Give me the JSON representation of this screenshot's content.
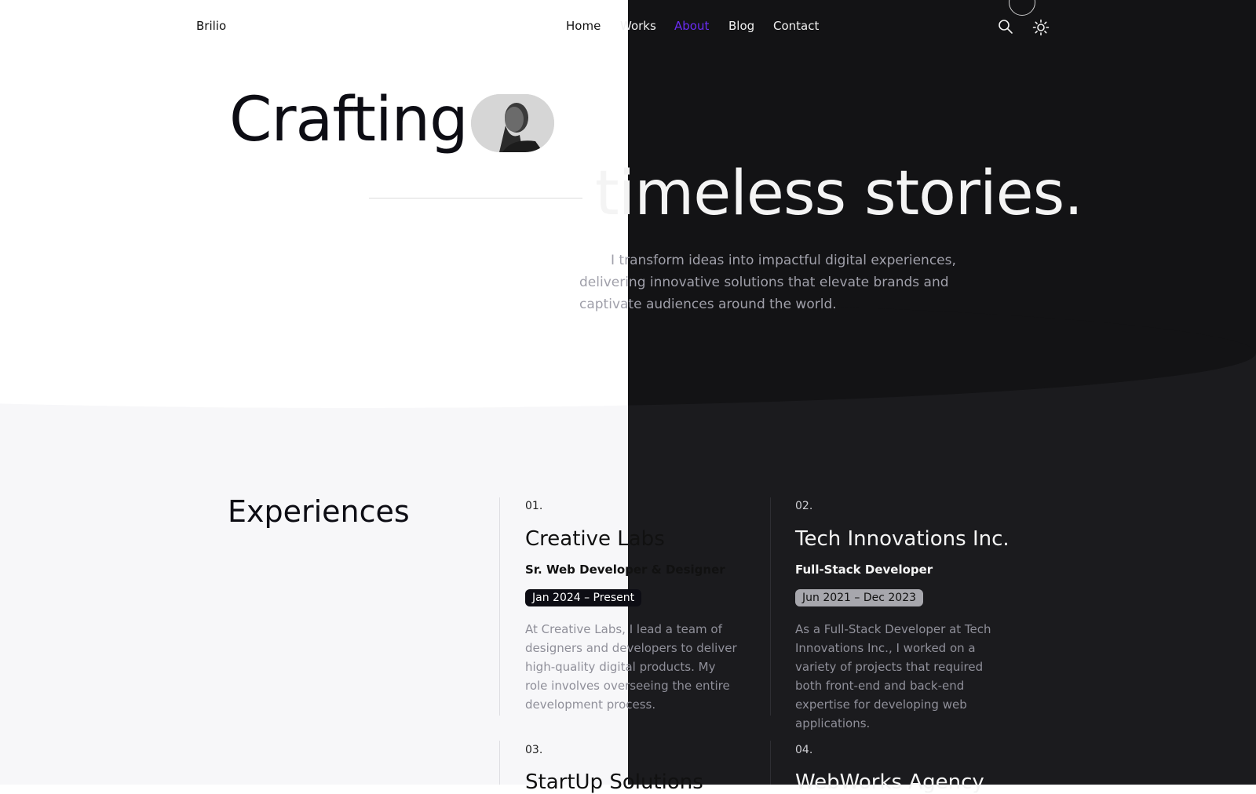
{
  "header": {
    "logo": "Brilio",
    "nav": [
      {
        "label": "Home"
      },
      {
        "label": "Works"
      },
      {
        "label": "About"
      },
      {
        "label": "Blog"
      },
      {
        "label": "Contact"
      }
    ],
    "active_nav": "About",
    "icons": [
      "search-icon",
      "sun-icon"
    ],
    "colors": {
      "accent": "#6b2cf5",
      "dark_bg": "#131315",
      "light_bg": "#ffffff"
    }
  },
  "hero": {
    "line1": "Crafting",
    "line2": "timeless stories.",
    "paragraph": "I transform ideas into impactful digital experiences, delivering innovative solutions that elevate brands and captivate audiences around the world."
  },
  "experiences": {
    "title": "Experiences",
    "items": [
      {
        "number": "01.",
        "company": "Creative Labs",
        "role": "Sr. Web Developer & Designer",
        "period": "Jan 2024 – Present",
        "description": "At Creative Labs, I lead a team of designers and developers to deliver high-quality digital products. My role involves overseeing the entire development process."
      },
      {
        "number": "02.",
        "company": "Tech Innovations Inc.",
        "role": "Full-Stack Developer",
        "period": "Jun 2021 – Dec 2023",
        "description": "As a Full-Stack Developer at Tech Innovations Inc., I worked on a variety of projects that required both front-end and back-end expertise for developing web applications."
      },
      {
        "number": "03.",
        "company": "StartUp Solutions"
      },
      {
        "number": "04.",
        "company": "WebWorks Agency"
      }
    ]
  }
}
